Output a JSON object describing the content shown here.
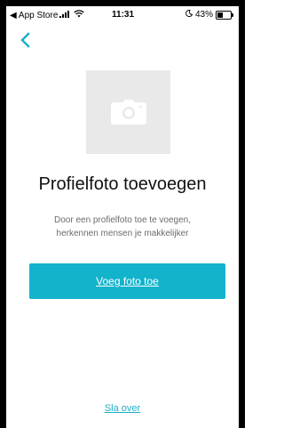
{
  "status_bar": {
    "carrier": "◀ App Store",
    "time": "11:31",
    "battery_percent": "43%"
  },
  "nav": {
    "back_icon": "chevron-left-icon"
  },
  "photo_placeholder": {
    "icon": "camera-icon"
  },
  "title": "Profielfoto toevoegen",
  "description_line1": "Door een profielfoto toe te voegen,",
  "description_line2": "herkennen mensen je makkelijker",
  "primary_button_label": "Voeg foto toe",
  "skip_link_label": "Sla over",
  "colors": {
    "accent": "#13b3cc",
    "placeholder_bg": "#e9e9e9"
  }
}
